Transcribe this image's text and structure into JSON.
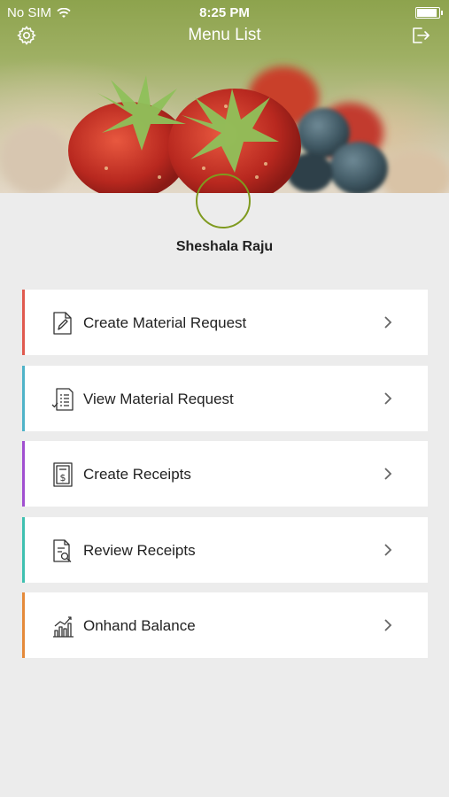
{
  "status_bar": {
    "carrier": "No SIM",
    "time": "8:25 PM",
    "battery_level": 0.85
  },
  "navbar": {
    "title": "Menu List",
    "settings_icon": "gear-icon",
    "logout_icon": "logout-icon"
  },
  "profile": {
    "name": "Sheshala Raju",
    "accent_color": "#7f9a1f"
  },
  "menu": {
    "items": [
      {
        "label": "Create Material Request",
        "icon": "edit-document-icon",
        "accent": "#e05a4f"
      },
      {
        "label": "View Material Request",
        "icon": "checklist-document-icon",
        "accent": "#4fb3c8"
      },
      {
        "label": "Create Receipts",
        "icon": "receipt-dollar-icon",
        "accent": "#a14fd0"
      },
      {
        "label": "Review Receipts",
        "icon": "document-search-icon",
        "accent": "#3fc0b0"
      },
      {
        "label": "Onhand Balance",
        "icon": "bar-chart-trend-icon",
        "accent": "#e58a3a"
      }
    ]
  }
}
